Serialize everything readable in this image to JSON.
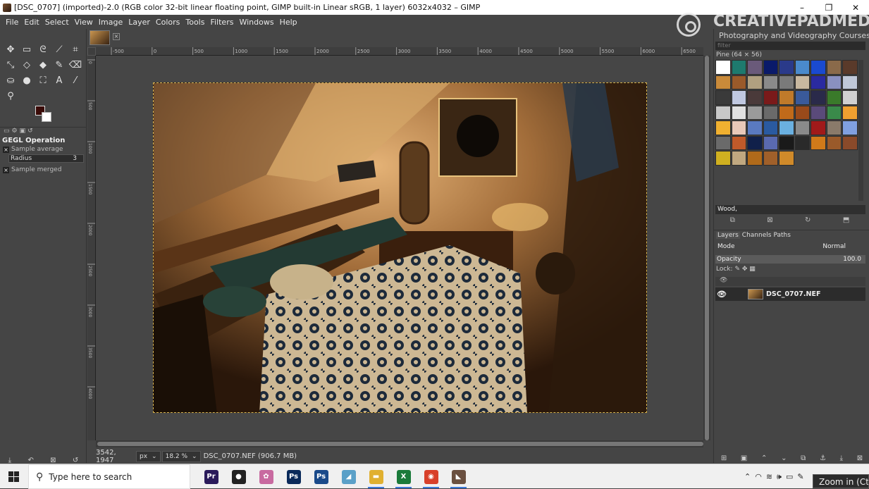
{
  "window": {
    "title": "[DSC_0707] (imported)-2.0 (RGB color 32-bit linear floating point, GIMP built-in Linear sRGB, 1 layer) 6032x4032 – GIMP",
    "buttons": {
      "minimize": "–",
      "maximize": "❐",
      "close": "✕"
    }
  },
  "menu": [
    "File",
    "Edit",
    "Select",
    "View",
    "Image",
    "Layer",
    "Colors",
    "Tools",
    "Filters",
    "Windows",
    "Help"
  ],
  "watermark": {
    "brand": "CREATIVEPADMEDIA",
    "tagline": "Photography and Videography Courses"
  },
  "toolbox": {
    "tools": [
      {
        "name": "move-tool-icon",
        "glyph": "✥"
      },
      {
        "name": "rect-select-icon",
        "glyph": "▭"
      },
      {
        "name": "lasso-icon",
        "glyph": "ᘓ"
      },
      {
        "name": "fuzzy-select-icon",
        "glyph": "⟋"
      },
      {
        "name": "crop-icon",
        "glyph": "⌗"
      },
      {
        "name": "unified-transform-icon",
        "glyph": "⤡"
      },
      {
        "name": "warp-icon",
        "glyph": "◇"
      },
      {
        "name": "bucket-fill-icon",
        "glyph": "◆"
      },
      {
        "name": "paintbrush-icon",
        "glyph": "✎"
      },
      {
        "name": "eraser-icon",
        "glyph": "⌫"
      },
      {
        "name": "clone-icon",
        "glyph": "⛀"
      },
      {
        "name": "smudge-icon",
        "glyph": "●"
      },
      {
        "name": "paths-icon",
        "glyph": "⛶"
      },
      {
        "name": "text-tool-icon",
        "glyph": "A"
      },
      {
        "name": "color-picker-icon",
        "glyph": "⁄"
      },
      {
        "name": "zoom-tool-icon",
        "glyph": "⚲"
      }
    ],
    "fg_color": "#3a0b08",
    "bg_color": "#ffffff",
    "options_title": "GEGL Operation",
    "sample_average_label": "Sample average",
    "radius_label": "Radius",
    "radius_value": "3",
    "sample_merged_label": "Sample merged"
  },
  "rulers": {
    "h_ticks": [
      "-500",
      "0",
      "500",
      "1000",
      "1500",
      "2000",
      "2500",
      "3000",
      "3500",
      "4000",
      "4500",
      "5000",
      "5500",
      "6000",
      "6500"
    ],
    "v_ticks": [
      "0",
      "500",
      "1000",
      "1500",
      "2000",
      "2500",
      "3000",
      "3500",
      "4000"
    ]
  },
  "status": {
    "coords": "3542, 1947",
    "unit": "px",
    "zoom": "18.2 %",
    "file_info": "DSC_0707.NEF (906.7 MB)"
  },
  "patterns": {
    "filter_placeholder": "filter",
    "title": "Pine (64 × 56)",
    "selected_name": "Wood,",
    "swatches": [
      "#ffffff",
      "#1e7a6e",
      "#6a5a7a",
      "#0a1a6a",
      "#2a3a8a",
      "#4a8acc",
      "#1a4ad0",
      "#8a6a4a",
      "#5a3a2a",
      "#c98a3a",
      "#9a5a2a",
      "#b0a080",
      "#8a8a8a",
      "#7a7a7a",
      "#c8b8a0",
      "#2a2aa0",
      "#8a90c0",
      "#c0c8d8",
      "#3a3a3a",
      "#c0c8e0",
      "#4a3a3a",
      "#7a1a1a",
      "#c07a2a",
      "#3a5a9a",
      "#2a2a4a",
      "#3a7a2a",
      "#d0d0d0",
      "#c8c8c8",
      "#e0e0e0",
      "#9a9a9a",
      "#6a6a6a",
      "#c06a1a",
      "#9a4a1a",
      "#5a4a7a",
      "#3a8a4a",
      "#f0a030",
      "#f0b030",
      "#e8c8b8",
      "#5a7ac0",
      "#2a5aa0",
      "#6ab0e0",
      "#8a8a8a",
      "#a01a1a",
      "#8a7a6a",
      "#80a0e0",
      "#6a6a6a",
      "#c05a2a",
      "#10204a",
      "#5a6ab0",
      "#1a1a1a",
      "#2a2a2a",
      "#d07a1a",
      "#9a5a2a",
      "#8a4a2a",
      "#d0b020",
      "#c0a880",
      "#b06a1a",
      "#a0602a",
      "#d08a2a"
    ]
  },
  "layers_dock": {
    "tabs": [
      "Layers",
      "Channels",
      "Paths"
    ],
    "mode_label": "Mode",
    "mode_value": "Normal",
    "opacity_label": "Opacity",
    "opacity_value": "100.0",
    "lock_label": "Lock:",
    "layer_name": "DSC_0707.NEF"
  },
  "taskbar": {
    "search_text": "Type here to search",
    "apps": [
      {
        "name": "premiere-icon",
        "label": "Pr",
        "color": "#2a1a5a"
      },
      {
        "name": "record-icon",
        "label": "●",
        "color": "#222"
      },
      {
        "name": "pinwheel-icon",
        "label": "✿",
        "color": "#c86aa0"
      },
      {
        "name": "photoshop-icon",
        "label": "Ps",
        "color": "#0a2a5a"
      },
      {
        "name": "photoshop-alt-icon",
        "label": "Ps",
        "color": "#1a4a8a"
      },
      {
        "name": "paper-icon",
        "label": "◢",
        "color": "#5aa0c8"
      },
      {
        "name": "file-explorer-icon",
        "label": "▬",
        "color": "#e0b030"
      },
      {
        "name": "excel-icon",
        "label": "X",
        "color": "#1a7a3a"
      },
      {
        "name": "chrome-icon",
        "label": "◉",
        "color": "#d8402a"
      },
      {
        "name": "gimp-icon",
        "label": "◣",
        "color": "#6a5040"
      }
    ],
    "tooltip": "Zoom in (Ctrl +)"
  }
}
